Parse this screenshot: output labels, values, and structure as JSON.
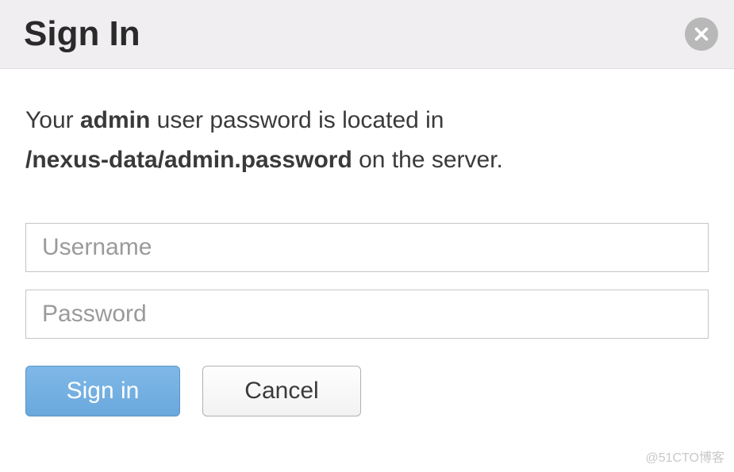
{
  "dialog": {
    "title": "Sign In",
    "info_prefix": "Your ",
    "info_user": "admin",
    "info_mid": " user password is located in ",
    "info_path": "/nexus-data/admin.password",
    "info_suffix": " on the server."
  },
  "form": {
    "username_placeholder": "Username",
    "password_placeholder": "Password"
  },
  "buttons": {
    "signin": "Sign in",
    "cancel": "Cancel"
  },
  "watermark": "@51CTO博客"
}
